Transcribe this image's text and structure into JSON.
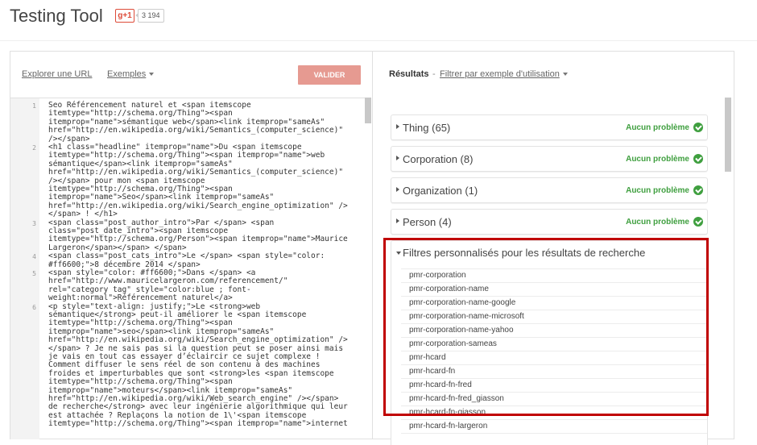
{
  "header": {
    "title": "Testing Tool",
    "gplus_label": "g+1",
    "share_count": "3 194"
  },
  "toolbar": {
    "explore_url": "Explorer une URL",
    "examples": "Exemples",
    "validate": "VALIDER"
  },
  "code_lines": [
    {
      "num": "1",
      "text": "Seo Référencement naturel et <span itemscope\nitemtype=\"http://schema.org/Thing\"><span\nitemprop=\"name\">sémantique web</span><link itemprop=\"sameAs\"\nhref=\"http://en.wikipedia.org/wiki/Semantics_(computer_science)\"\n/></span>"
    },
    {
      "num": "2",
      "text": "<h1 class=\"headline\" itemprop=\"name\">Du <span itemscope\nitemtype=\"http://schema.org/Thing\"><span itemprop=\"name\">web\nsémantique</span><link itemprop=\"sameAs\"\nhref=\"http://en.wikipedia.org/wiki/Semantics_(computer_science)\"\n/></span> pour mon <span itemscope\nitemtype=\"http://schema.org/Thing\"><span\nitemprop=\"name\">Seo</span><link itemprop=\"sameAs\"\nhref=\"http://en.wikipedia.org/wiki/Search_engine_optimization\" />\n</span> ! </h1>"
    },
    {
      "num": "3",
      "text": "<span class=\"post_author_intro\">Par </span> <span\nclass=\"post_date_intro\"><span itemscope\nitemtype=\"http://schema.org/Person\"><span itemprop=\"name\">Maurice\nLargeron</span></span> </span>"
    },
    {
      "num": "4",
      "text": "<span class=\"post_cats_intro\">Le </span> <span style=\"color:\n#ff6600;\">8 décembre 2014 </span>"
    },
    {
      "num": "5",
      "text": "<span style=\"color: #ff6600;\">Dans </span> <a\nhref=\"http://www.mauricelargeron.com/referencement/\"\nrel=\"category tag\" style=\"color:blue ; font-\nweight:normal\">Référencement naturel</a>"
    },
    {
      "num": "6",
      "text": "<p style=\"text-align: justify;\">Le <strong>web\nsémantique</strong> peut-il améliorer le <span itemscope\nitemtype=\"http://schema.org/Thing\"><span\nitemprop=\"name\">seo</span><link itemprop=\"sameAs\"\nhref=\"http://en.wikipedia.org/wiki/Search_engine_optimization\" />\n</span> ? Je ne sais pas si la question peut se poser ainsi mais\nje vais en tout cas essayer d’éclaircir ce sujet complexe !\nComment diffuser le sens réel de son contenu à des machines\nfroides et imperturbables que sont <strong>les <span itemscope\nitemtype=\"http://schema.org/Thing\"><span\nitemprop=\"name\">moteurs</span><link itemprop=\"sameAs\"\nhref=\"http://en.wikipedia.org/wiki/Web_search_engine\" /></span>\nde recherche</strong> avec leur ingénierie algorithmique qui leur\nest attachée ? Replaçons la notion de 1\\'<span itemscope\nitemtype=\"http://schema.org/Thing\"><span itemprop=\"name\">internet"
    }
  ],
  "results": {
    "label": "Résultats",
    "separator": "-",
    "filter_link": "Filtrer par exemple d'utilisation",
    "items": [
      {
        "label": "Thing (65)",
        "status": "Aucun problème"
      },
      {
        "label": "Corporation (8)",
        "status": "Aucun problème"
      },
      {
        "label": "Organization (1)",
        "status": "Aucun problème"
      },
      {
        "label": "Person (4)",
        "status": "Aucun problème"
      }
    ],
    "filters_title": "Filtres personnalisés pour les résultats de recherche",
    "filters": [
      "pmr-corporation",
      "pmr-corporation-name",
      "pmr-corporation-name-google",
      "pmr-corporation-name-microsoft",
      "pmr-corporation-name-yahoo",
      "pmr-corporation-sameas",
      "pmr-hcard",
      "pmr-hcard-fn",
      "pmr-hcard-fn-fred",
      "pmr-hcard-fn-fred_giasson",
      "pmr-hcard-fn-giasson",
      "pmr-hcard-fn-largeron"
    ]
  },
  "colors": {
    "accent_button": "#e69a91",
    "ok_green": "#3f9f3f",
    "highlight_red": "#c00000"
  },
  "icons": {
    "status": "check-circle-icon",
    "expand": "triangle-right-icon",
    "collapse": "triangle-down-icon",
    "dropdown": "caret-down-icon"
  }
}
